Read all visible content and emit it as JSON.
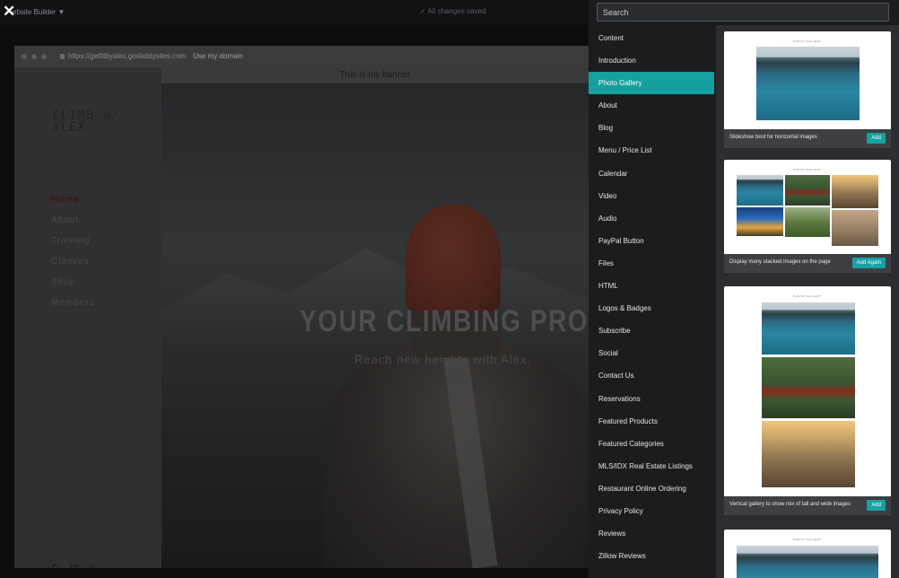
{
  "topbar": {
    "close_icon": "close-icon",
    "app_label": "ebsite Builder",
    "app_dropdown_icon": "caret-down-icon",
    "save_status": "All changes saved"
  },
  "browser": {
    "url": "https://getfitbyalex.godaddysites.com",
    "use_domain": "Use my domain"
  },
  "site": {
    "logo": "CLIMB W/ ALEX",
    "banner": "This is my banner",
    "nav": [
      "Home",
      "About",
      "Training",
      "Classes",
      "Shop",
      "Members"
    ],
    "active_nav": "Home",
    "hero_title": "YOUR CLIMBING PRO",
    "hero_subtitle": "Reach new heights with Alex.",
    "footer_icons": [
      "search-icon",
      "cart-icon",
      "account-icon"
    ]
  },
  "panel": {
    "search_placeholder": "Search",
    "categories": [
      "Content",
      "Introduction",
      "Photo Gallery",
      "About",
      "Blog",
      "Menu / Price List",
      "Calendar",
      "Video",
      "Audio",
      "PayPal Button",
      "Files",
      "HTML",
      "Logos & Badges",
      "Subscribe",
      "Social",
      "Contact Us",
      "Reservations",
      "Featured Products",
      "Featured Categories",
      "MLS/IDX Real Estate Listings",
      "Restaurant Online Ordering",
      "Privacy Policy",
      "Reviews",
      "Zillow Reviews"
    ],
    "selected_category": "Photo Gallery",
    "cards": [
      {
        "mini_title": "PHOTO GALLERY",
        "caption": "Slideshow best for horizontal images",
        "button": "Add"
      },
      {
        "mini_title": "PHOTO GALLERY",
        "caption": "Display many stacked images on the page",
        "button": "Add Again"
      },
      {
        "mini_title": "PHOTO GALLERY",
        "caption": "Vertical gallery to show mix of tall and wide images",
        "button": "Add"
      },
      {
        "mini_title": "PHOTO GALLERY"
      }
    ]
  },
  "colors": {
    "accent": "#159f9f",
    "panel_bg": "#1b1c1e",
    "card_area_bg": "#2b2d31"
  }
}
